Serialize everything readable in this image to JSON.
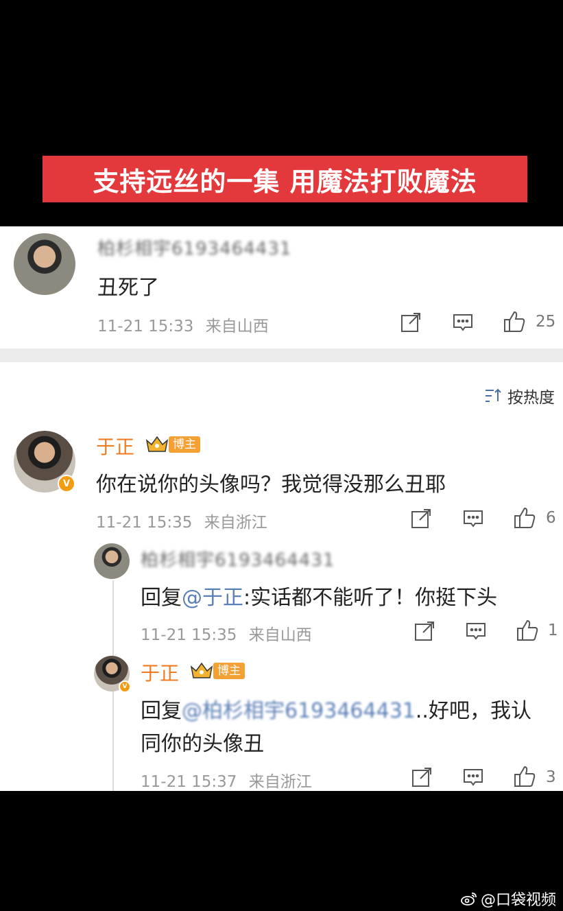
{
  "banner": "支持远丝的一集 用魔法打败魔法",
  "comment1": {
    "username": "柏杉相宇6193464431",
    "text": "丑死了",
    "time": "11-21 15:33",
    "location": "来自山西",
    "likes": "25"
  },
  "sort_label": "按热度",
  "comment2": {
    "username": "于正",
    "badge": "博主",
    "text": "你在说你的头像吗？我觉得没那么丑耶",
    "time": "11-21 15:35",
    "location": "来自浙江",
    "likes": "6"
  },
  "reply1": {
    "username": "柏杉相宇6193464431",
    "prefix": "回复",
    "mention": "@于正",
    "text": ":实话都不能听了！你挺下头",
    "time": "11-21 15:35",
    "location": "来自山西",
    "likes": "1"
  },
  "reply2": {
    "username": "于正",
    "badge": "博主",
    "prefix": "回复",
    "mention": "@柏杉相宇6193464431",
    "text_line1": "..好吧，我认",
    "text_line2": "同你的头像丑",
    "time": "11-21 15:37",
    "location": "来自浙江",
    "likes": "3"
  },
  "watermark": "@口袋视频",
  "colors": {
    "banner_bg": "#e4393c",
    "username": "#f07c22",
    "mention": "#5a7fb5",
    "badge": "#f3a134"
  }
}
